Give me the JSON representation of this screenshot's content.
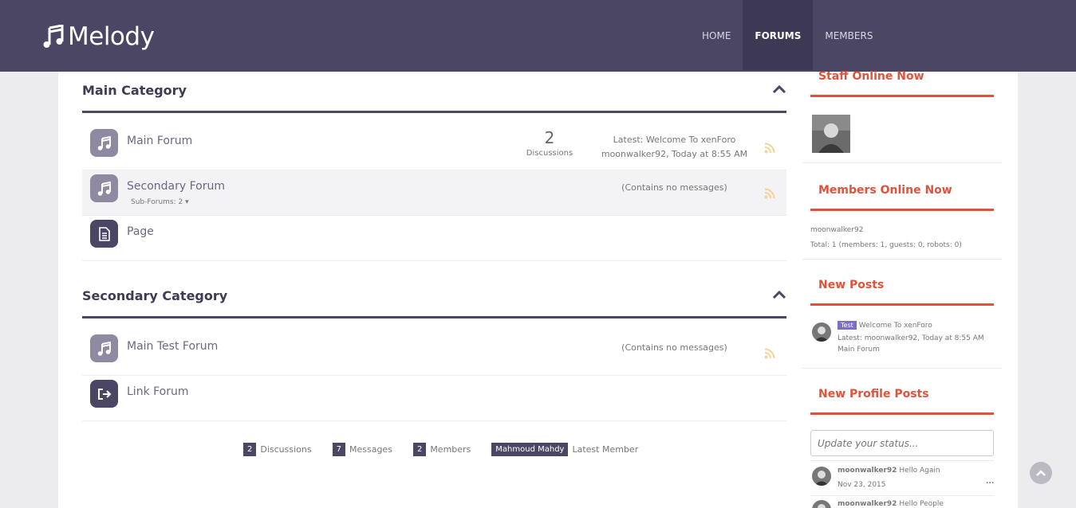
{
  "brand": {
    "name": "Melody"
  },
  "nav": {
    "home": "HOME",
    "forums": "FORUMS",
    "members": "MEMBERS"
  },
  "categories": [
    {
      "title": "Main Category",
      "nodes": [
        {
          "title": "Main Forum",
          "stat_number": "2",
          "stat_label": "Discussions",
          "latest_line1": "Latest: Welcome To xenForo",
          "latest_line2": "moonwalker92, Today at 8:55 AM"
        },
        {
          "title": "Secondary Forum",
          "subforums": "Sub-Forums: 2",
          "latest_line1": "(Contains no messages)"
        },
        {
          "title": "Page"
        }
      ]
    },
    {
      "title": "Secondary Category",
      "nodes": [
        {
          "title": "Main Test Forum",
          "latest_line1": "(Contains no messages)"
        },
        {
          "title": "Link Forum"
        }
      ]
    }
  ],
  "stats": {
    "discussions_count": "2",
    "discussions_label": "Discussions",
    "messages_count": "7",
    "messages_label": "Messages",
    "members_count": "2",
    "members_label": "Members",
    "latest_member": "Mahmoud Mahdy",
    "latest_member_label": "Latest Member"
  },
  "sidebar": {
    "staff_title": "Staff Online Now",
    "members_title": "Members Online Now",
    "members_online_name": "moonwalker92",
    "members_total": "Total: 1 (members: 1, guests: 0, robots: 0)",
    "new_posts_title": "New Posts",
    "new_post": {
      "tag": "Test",
      "title": "Welcome To xenForo",
      "latest": "Latest: moonwalker92, Today at 8:55 AM",
      "forum": "Main Forum"
    },
    "profile_posts_title": "New Profile Posts",
    "status_placeholder": "Update your status...",
    "profile_posts": [
      {
        "user": "moonwalker92",
        "text": "Hello Again",
        "date": "Nov 23, 2015",
        "more": "..."
      },
      {
        "user": "moonwalker92",
        "text": "Hello People"
      }
    ]
  },
  "colors": {
    "header": "#4b4664",
    "accent": "#e0533a",
    "tag": "#7d70c4"
  }
}
